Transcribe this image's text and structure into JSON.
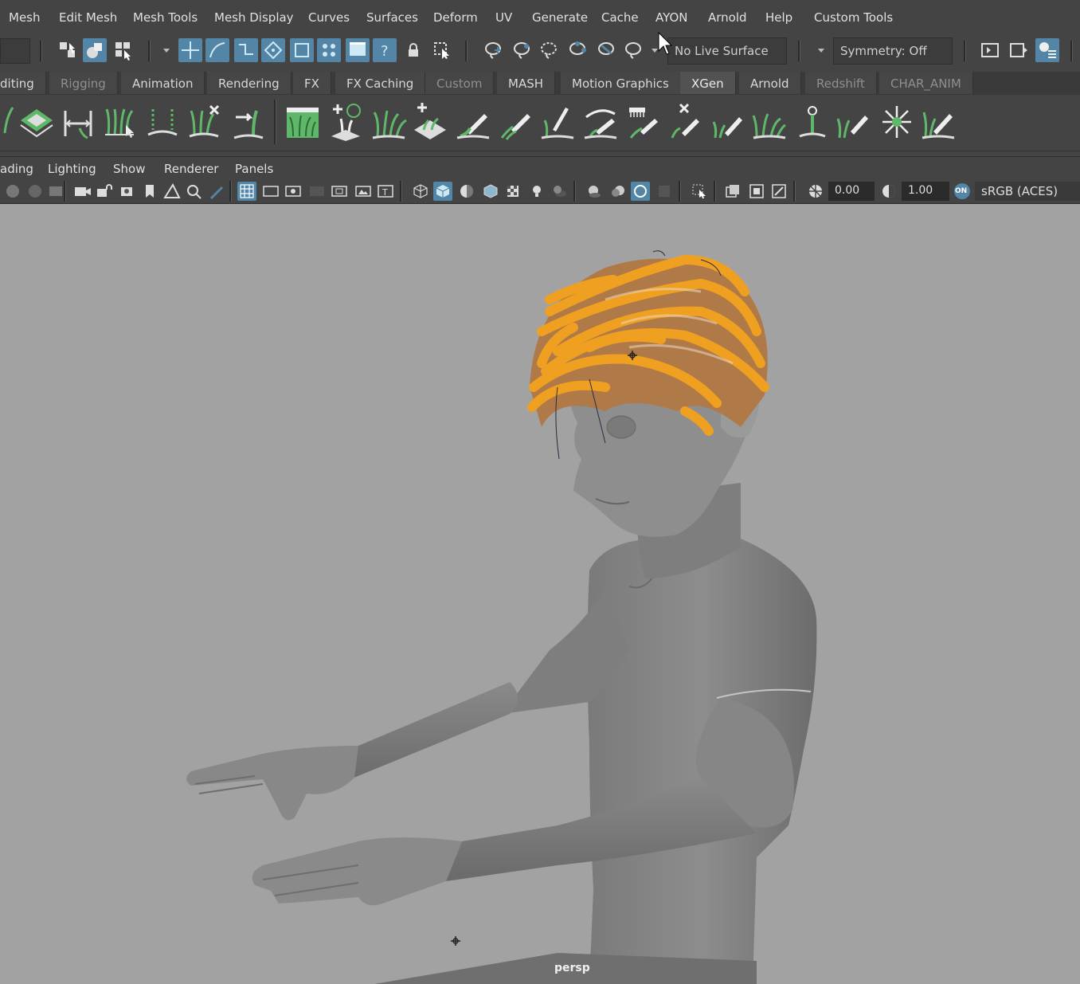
{
  "menubar": {
    "items": [
      "Mesh",
      "Edit Mesh",
      "Mesh Tools",
      "Mesh Display",
      "Curves",
      "Surfaces",
      "Deform",
      "UV",
      "Generate",
      "Cache",
      "AYON",
      "Arnold",
      "Help",
      "Custom Tools"
    ]
  },
  "statusline": {
    "live_surface": "No Live Surface",
    "symmetry": "Symmetry: Off"
  },
  "shelf_tabs": {
    "items": [
      {
        "label": "diting",
        "state": "normal"
      },
      {
        "label": "Rigging",
        "state": "dim"
      },
      {
        "label": "Animation",
        "state": "normal"
      },
      {
        "label": "Rendering",
        "state": "normal"
      },
      {
        "label": "FX",
        "state": "normal"
      },
      {
        "label": "FX Caching",
        "state": "normal"
      },
      {
        "label": "Custom",
        "state": "dim"
      },
      {
        "label": "MASH",
        "state": "normal"
      },
      {
        "label": "Motion Graphics",
        "state": "normal"
      },
      {
        "label": "XGen",
        "state": "active"
      },
      {
        "label": "Arnold",
        "state": "normal"
      },
      {
        "label": "Redshift",
        "state": "dim"
      },
      {
        "label": "CHAR_ANIM",
        "state": "dim"
      }
    ]
  },
  "panel_menu": {
    "items": [
      "ading",
      "Lighting",
      "Show",
      "Renderer",
      "Panels"
    ]
  },
  "panel_toolbar": {
    "exposure": "0.00",
    "gamma": "1.00",
    "color_mgmt_badge": "ON",
    "color_space": "sRGB (ACES)"
  },
  "viewport": {
    "camera": "persp",
    "background": "#a2a2a2",
    "hair_color": "#f0a020"
  },
  "colors": {
    "active_icon": "#5285a6",
    "xgen_green": "#5fb86a"
  }
}
